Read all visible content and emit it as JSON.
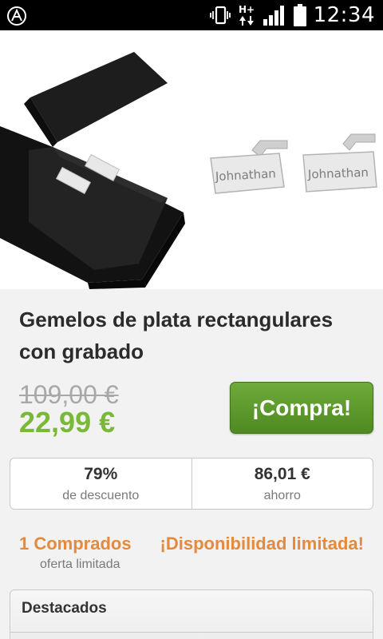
{
  "status_bar": {
    "network_type": "H+",
    "time": "12:34"
  },
  "product": {
    "image_engraving_text": "Johnathan",
    "title": "Gemelos de plata rectangulares con grabado",
    "old_price": "109,00 €",
    "new_price": "22,99 €",
    "buy_button_label": "¡Compra!"
  },
  "stats": {
    "discount_value": "79%",
    "discount_label": "de descuento",
    "savings_value": "86,01 €",
    "savings_label": "ahorro"
  },
  "availability": {
    "purchased_text": "1 Comprados",
    "purchased_subtext": "oferta limitada",
    "limited_text": "¡Disponibilidad limitada!"
  },
  "featured": {
    "title": "Destacados"
  },
  "colors": {
    "price_green": "#7ab837",
    "button_green": "#5c9a2c",
    "accent_orange": "#e58a3c"
  }
}
